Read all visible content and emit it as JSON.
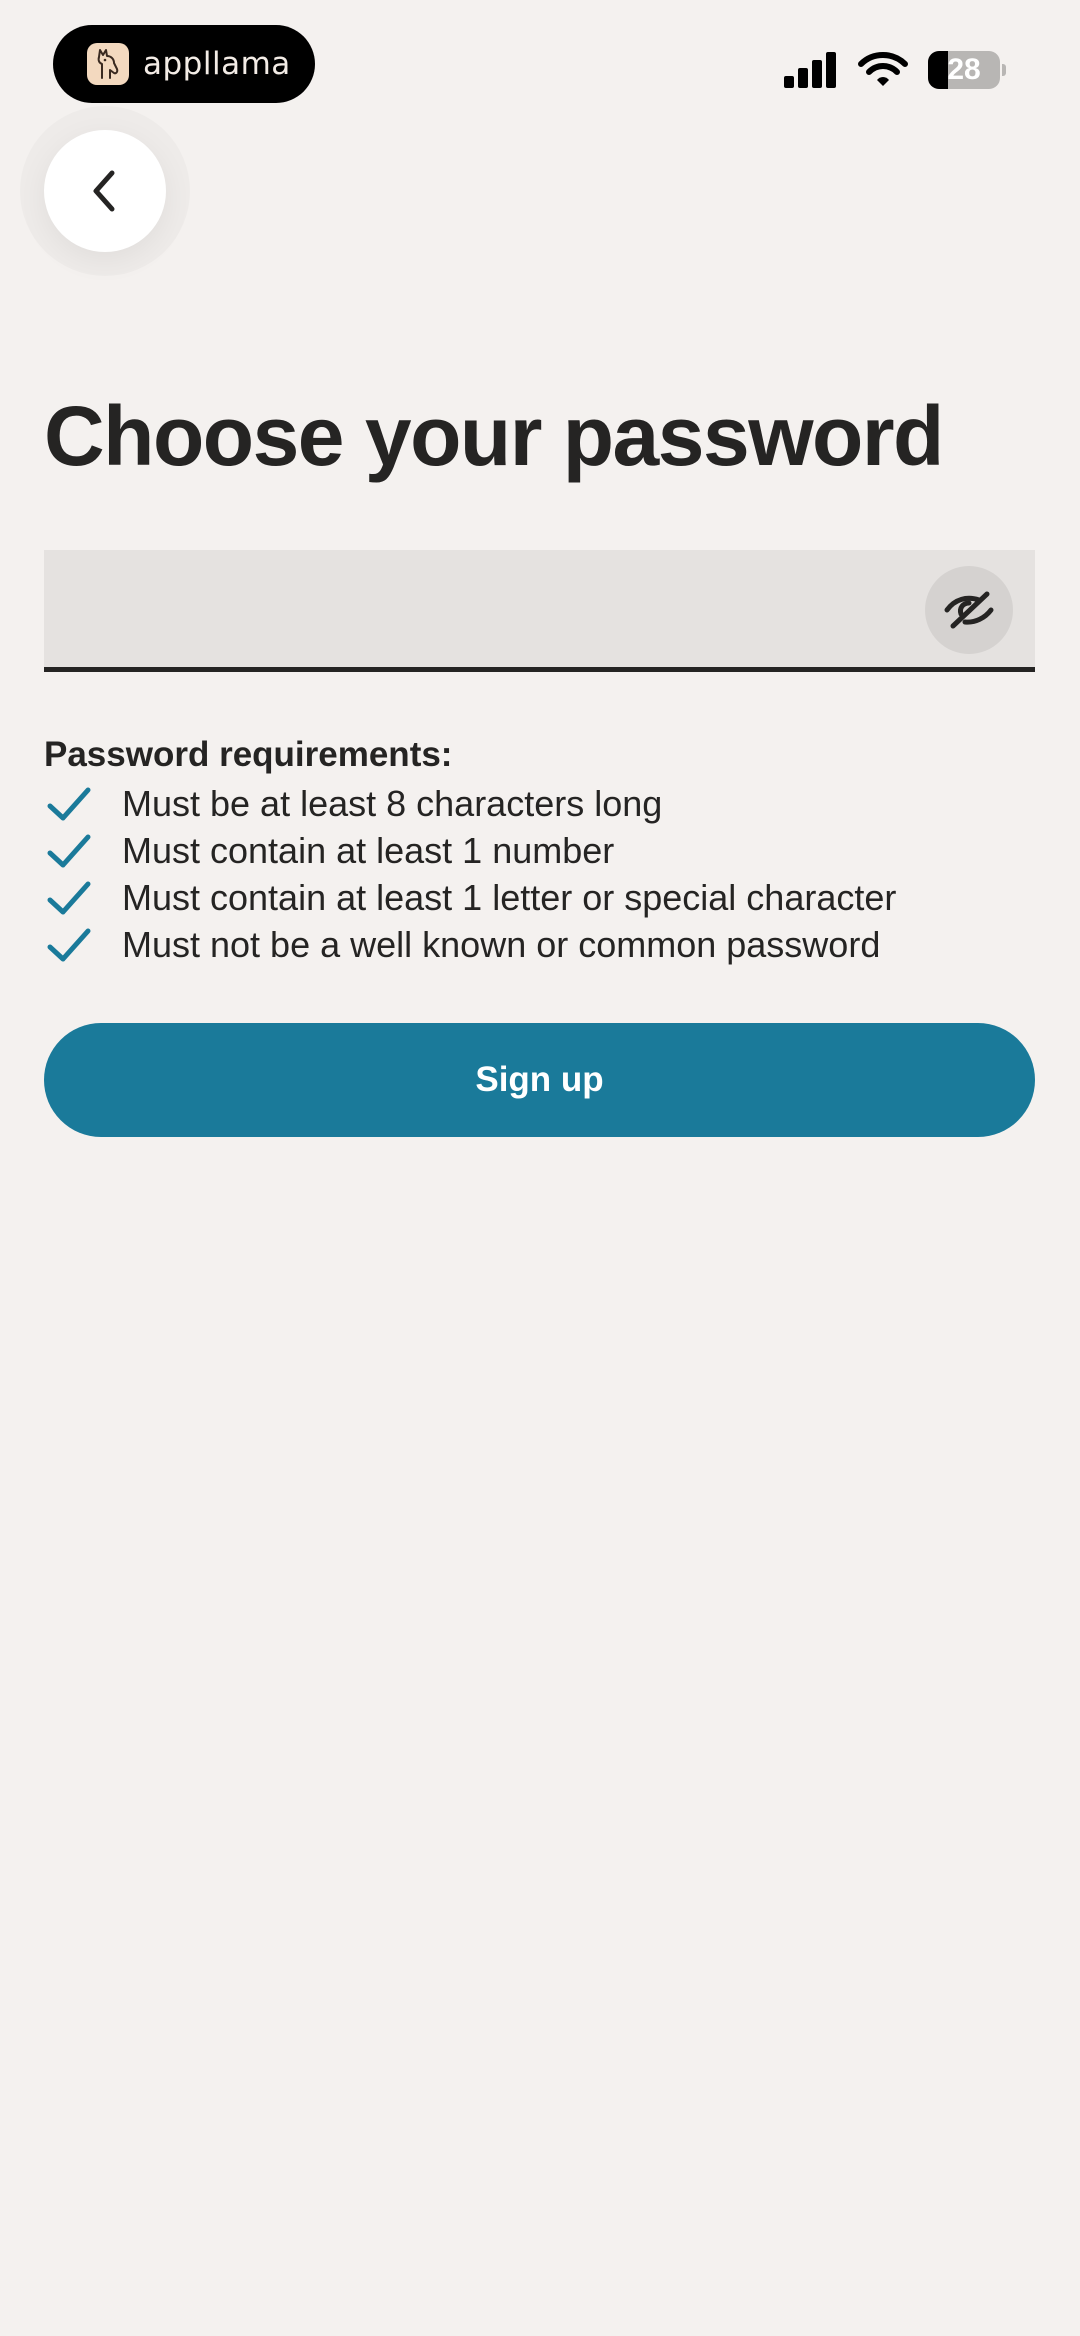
{
  "status_bar": {
    "app_name": "appllama",
    "battery_level": "28",
    "icons": [
      "llama-logo-icon",
      "signal-icon",
      "wifi-icon",
      "battery-icon"
    ]
  },
  "nav": {
    "back_icon": "chevron-left-icon"
  },
  "title": "Choose your password",
  "password_field": {
    "value": "",
    "placeholder": "",
    "toggle_icon": "eye-slash-icon"
  },
  "requirements": {
    "heading": "Password requirements:",
    "items": [
      {
        "text": "Must be at least 8 characters long",
        "met": true
      },
      {
        "text": "Must contain at least 1 number",
        "met": true
      },
      {
        "text": "Must contain at least 1 letter or special character",
        "met": true
      },
      {
        "text": "Must not be a well known or common password",
        "met": true
      }
    ]
  },
  "signup_button": {
    "label": "Sign up"
  },
  "colors": {
    "background": "#f4f1ef",
    "accent": "#1a7a9a",
    "text": "#252423",
    "field_background": "#e5e2e0"
  }
}
